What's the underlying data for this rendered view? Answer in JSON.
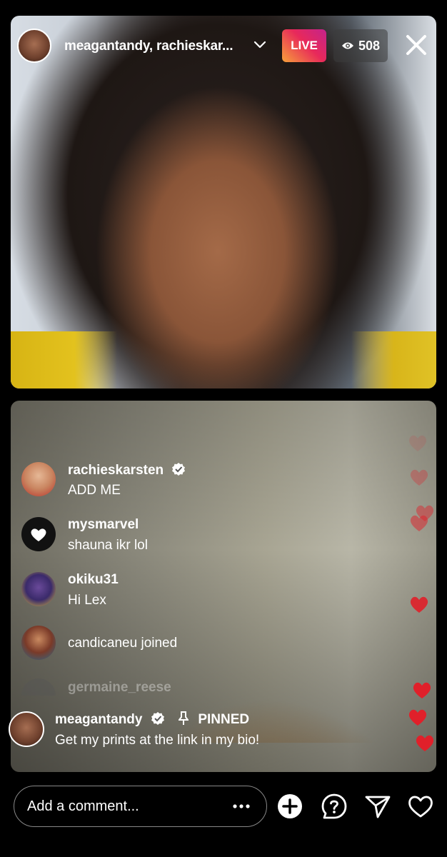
{
  "header": {
    "host_names": "meagantandy, rachieskar...",
    "live_label": "LIVE",
    "viewer_count": "508"
  },
  "comments": [
    {
      "username": "rachieskarsten",
      "verified": true,
      "text": "ADD ME"
    },
    {
      "username": "mysmarvel",
      "verified": false,
      "text": "shauna ikr lol"
    },
    {
      "username": "okiku31",
      "verified": false,
      "text": "Hi Lex"
    }
  ],
  "joined": [
    {
      "text": "candicaneu joined"
    },
    {
      "text": "germaine_reese"
    }
  ],
  "pinned": {
    "username": "meagantandy",
    "label": "PINNED",
    "text": "Get my prints at the link in my bio!"
  },
  "comment_bar": {
    "placeholder": "Add a comment..."
  },
  "colors": {
    "live_gradient_start": "#f7a13a",
    "live_gradient_end": "#c4238c",
    "heart_red": "#e0202a",
    "verified_blue": "#ffffff"
  },
  "icons": [
    "chevron-down-icon",
    "eye-icon",
    "close-icon",
    "verified-icon",
    "pin-icon",
    "more-icon",
    "add-icon",
    "question-icon",
    "send-icon",
    "heart-icon"
  ]
}
